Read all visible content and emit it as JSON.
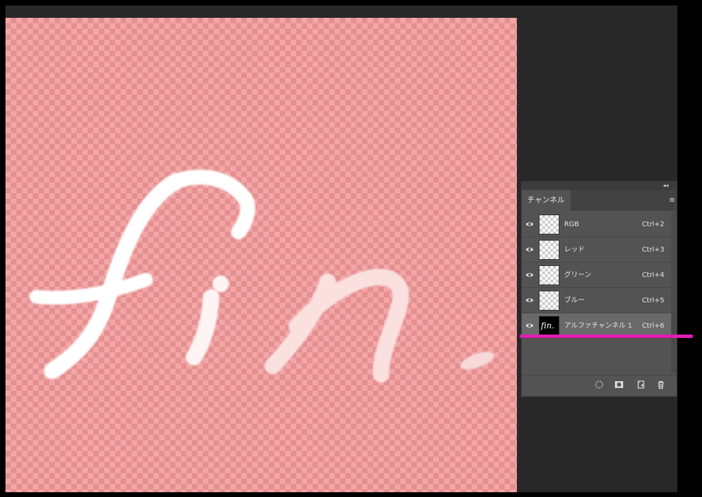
{
  "canvas": {
    "artwork_text": "fin."
  },
  "panel": {
    "tab_label": "チャンネル",
    "channels": [
      {
        "name": "RGB",
        "shortcut": "Ctrl+2"
      },
      {
        "name": "レッド",
        "shortcut": "Ctrl+3"
      },
      {
        "name": "グリーン",
        "shortcut": "Ctrl+4"
      },
      {
        "name": "ブルー",
        "shortcut": "Ctrl+5"
      },
      {
        "name": "アルファチャンネル 1",
        "shortcut": "Ctrl+6"
      }
    ],
    "collapse_glyph": "◂◂",
    "menu_glyph": "≡"
  },
  "colors": {
    "annotation": "#e01cb4",
    "quick_mask_overlay": "#f3a6a6",
    "panel_bg": "#535353"
  }
}
